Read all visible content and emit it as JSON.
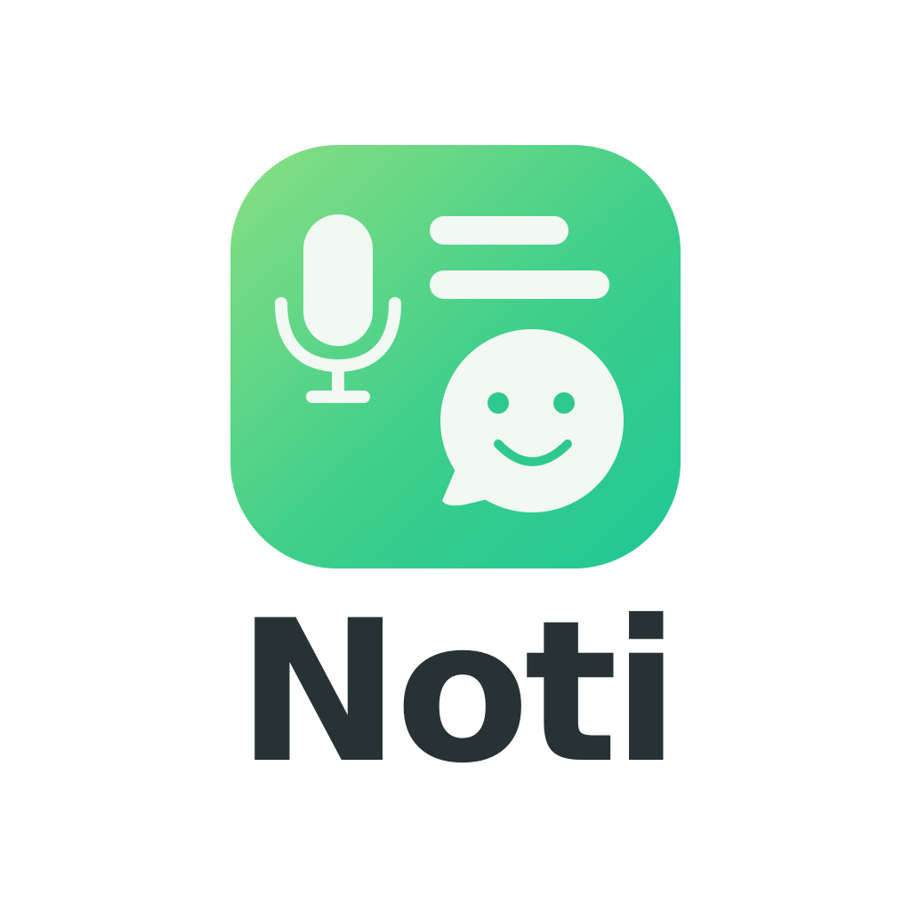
{
  "brand": {
    "name": "Noti",
    "text_color": "#263234",
    "gradient_start": "#8ADF82",
    "gradient_end": "#1FC796",
    "glyph_color": "#F2F8F3"
  },
  "icons": {
    "app": "app-icon",
    "microphone": "microphone-icon",
    "text_lines": "text-lines-icon",
    "chat": "smiley-chat-bubble-icon"
  }
}
